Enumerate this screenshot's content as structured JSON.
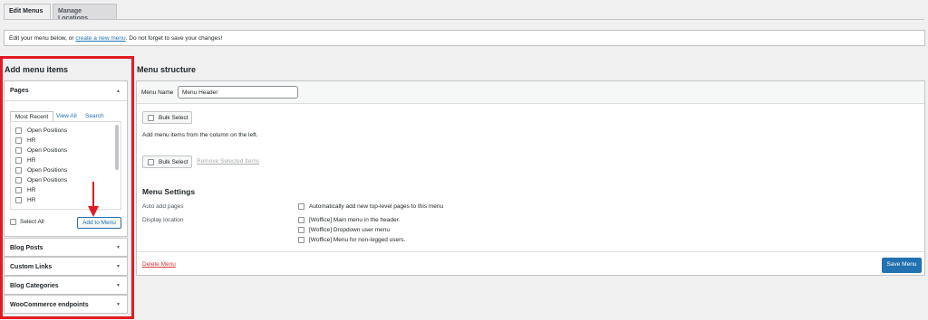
{
  "tabs": {
    "edit_menus": "Edit Menus",
    "manage_locations": "Manage Locations"
  },
  "notice": {
    "prefix": "Edit your menu below, or ",
    "link": "create a new menu",
    "suffix": ". Do not forget to save your changes!"
  },
  "left": {
    "heading": "Add menu items",
    "pages": {
      "title": "Pages",
      "tabs": [
        "Most Recent",
        "View All",
        "Search"
      ],
      "items": [
        "Open Positions",
        "HR",
        "Open Positions",
        "HR",
        "Open Positions",
        "Open Positions",
        "HR",
        "HR"
      ],
      "select_all": "Select All",
      "add_button": "Add to Menu"
    },
    "sections": [
      "Blog Posts",
      "Custom Links",
      "Blog Categories",
      "WooCommerce endpoints"
    ]
  },
  "right": {
    "heading": "Menu structure",
    "menu_name_label": "Menu Name",
    "menu_name_value": "Menu Header",
    "bulk_select": "Bulk Select",
    "hint": "Add menu items from the column on the left.",
    "remove_selected": "Remove Selected Items",
    "settings_title": "Menu Settings",
    "auto_add_label": "Auto add pages",
    "auto_add_option": "Automatically add new top-level pages to this menu",
    "display_location_label": "Display location",
    "locations": [
      "[Woffice] Main menu in the header.",
      "[Woffice] Dropdown user menu",
      "[Woffice] Menu for non-logged users."
    ],
    "delete_menu": "Delete Menu",
    "save_menu": "Save Menu"
  },
  "colors": {
    "accent": "#2271b1",
    "highlight_box": "#e31b23",
    "arrow": "#e31b23"
  }
}
